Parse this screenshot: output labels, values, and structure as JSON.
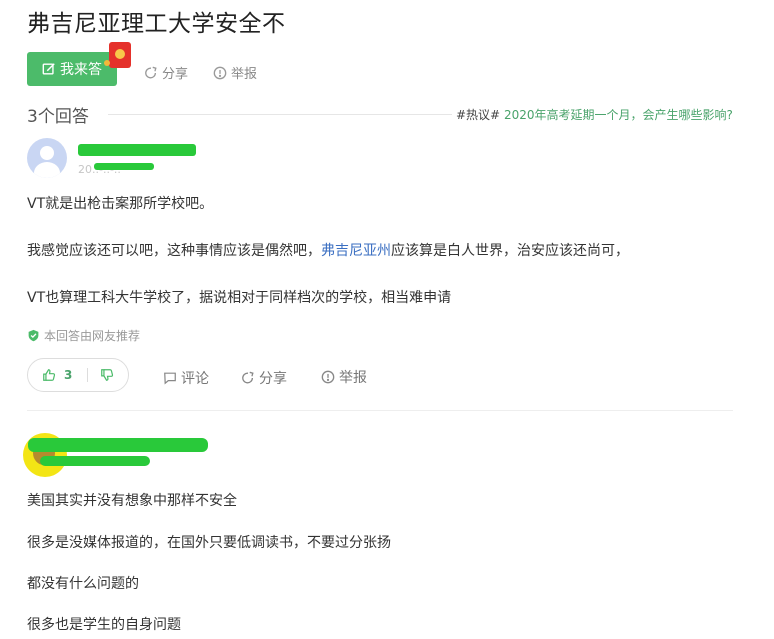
{
  "question": {
    "title": "弗吉尼亚理工大学安全不"
  },
  "actions": {
    "answer_label": "我来答",
    "share_label": "分享",
    "report_label": "举报"
  },
  "answers_header": {
    "count_label": "3个回答",
    "hot_tag": "#热议#",
    "hot_topic": "2020年高考延期一个月，会产生哪些影响?"
  },
  "answer1": {
    "user_ghost": "r...",
    "date_ghost": "20..-..-..",
    "paragraphs": [
      "VT就是出枪击案那所学校吧。",
      "VT也算理工科大牛学校了，据说相对于同样档次的学校，相当难申请"
    ],
    "p2_before": "我感觉应该还可以吧，这种事情应该是偶然吧，",
    "p2_link": "弗吉尼亚州",
    "p2_after": "应该算是白人世界，治安应该还尚可，",
    "recommend_text": "本回答由网友推荐",
    "likes": "3",
    "comment_label": "评论",
    "share_label": "分享",
    "report_label": "举报"
  },
  "answer2": {
    "paragraphs": [
      "美国其实并没有想象中那样不安全",
      "很多是没媒体报道的，在国外只要低调读书，不要过分张扬",
      "都没有什么问题的",
      "很多也是学生的自身问题"
    ]
  },
  "colors": {
    "accent": "#4cbb6a",
    "link": "#3b6fc2",
    "redaction": "#29c93a"
  }
}
